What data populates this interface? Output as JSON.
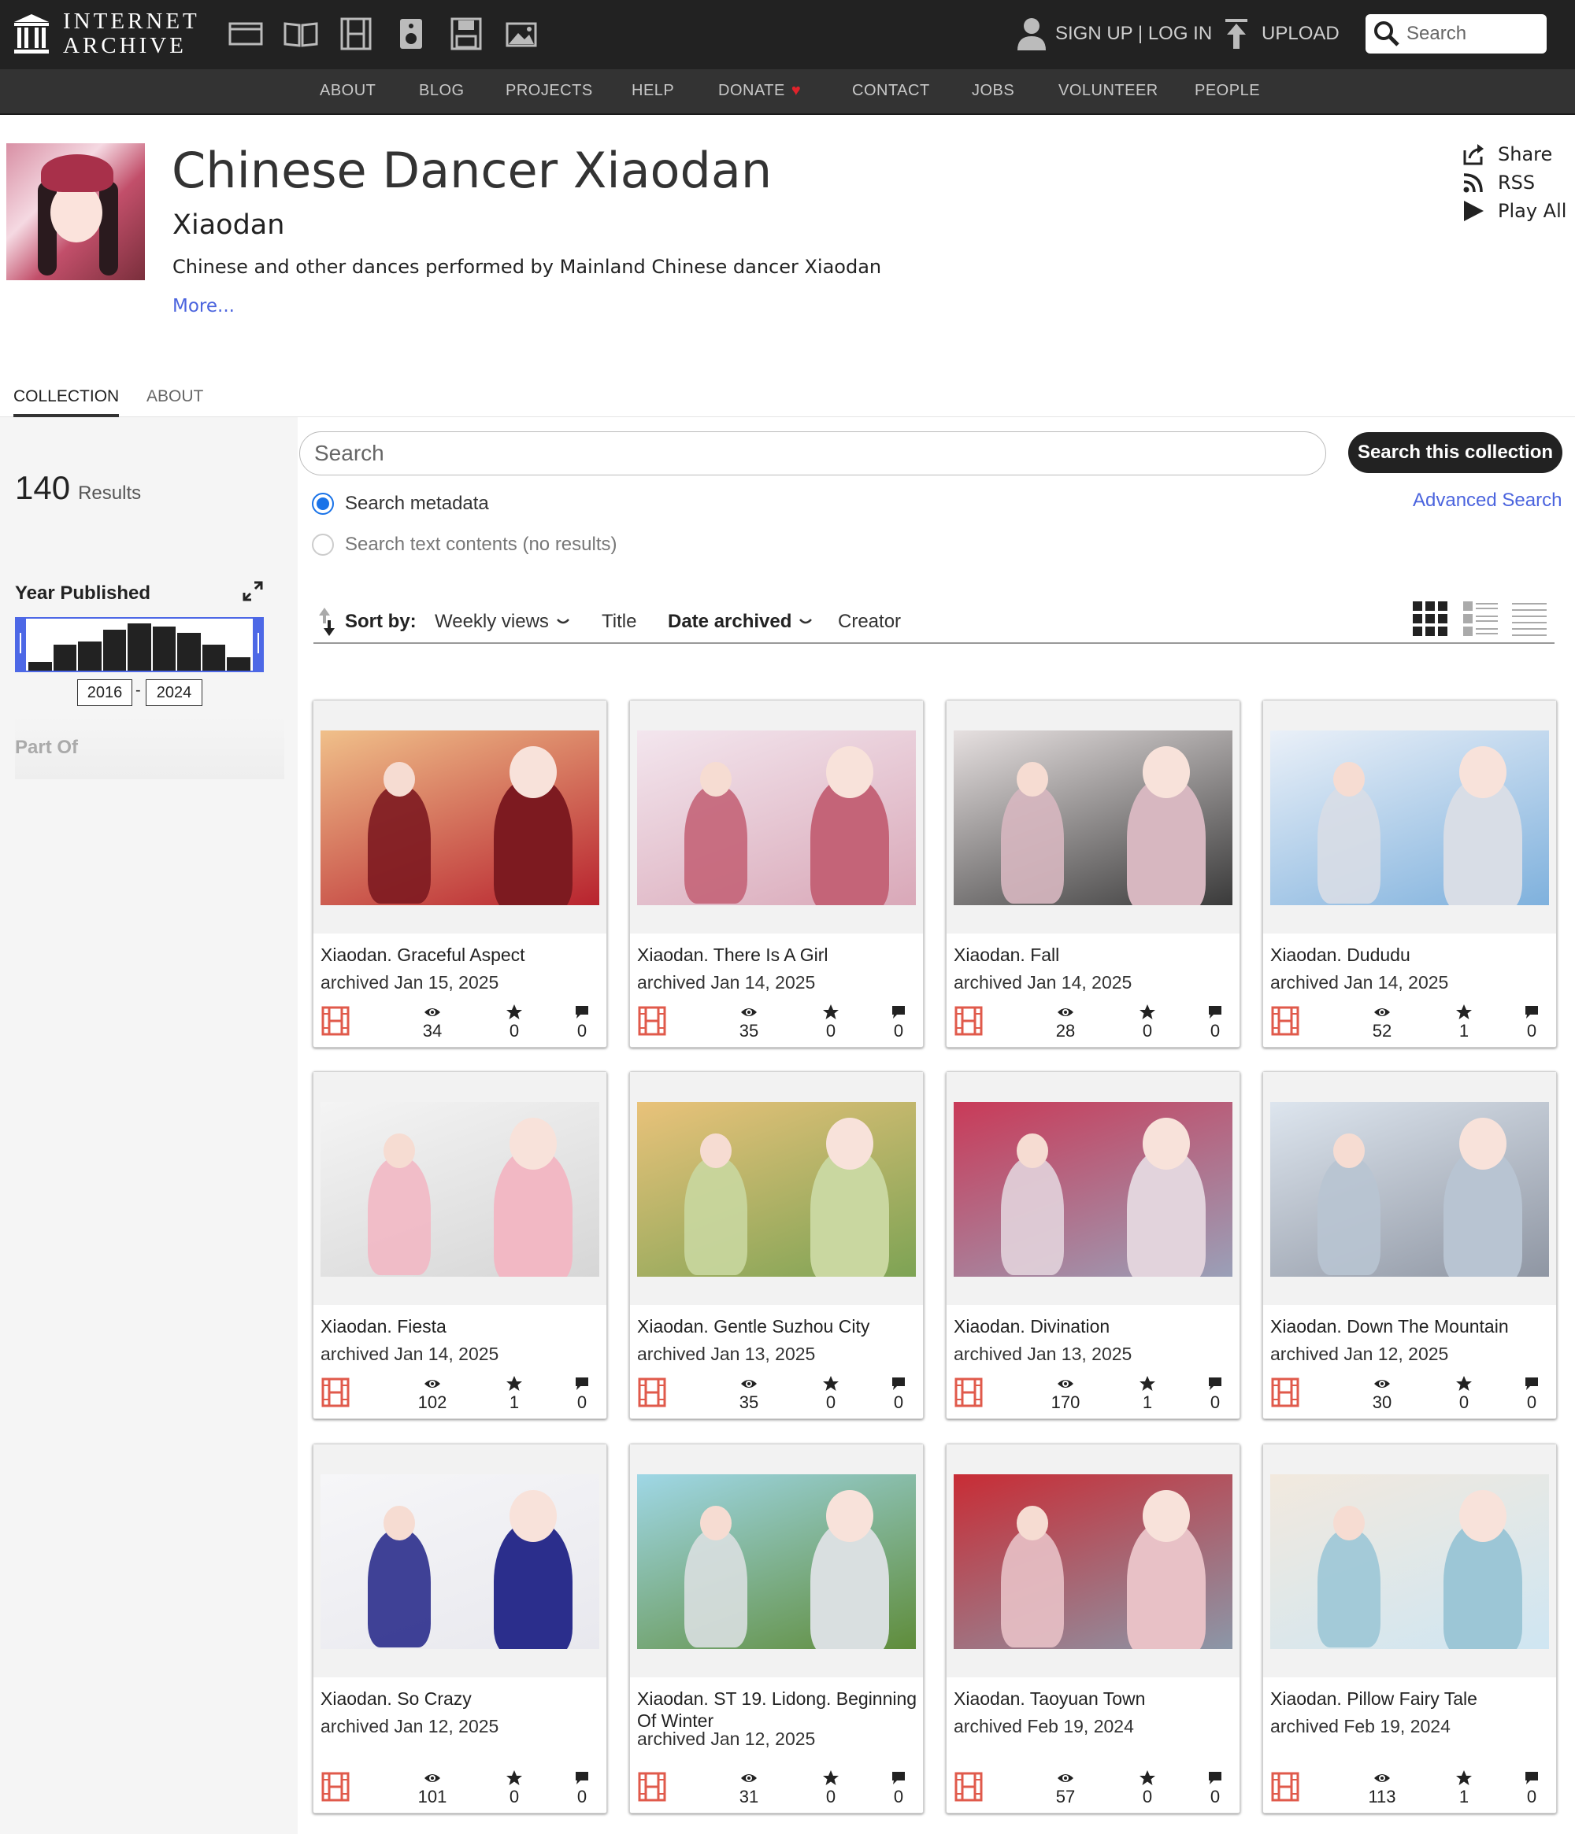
{
  "topbar": {
    "logo_line1": "INTERNET",
    "logo_line2": "ARCHIVE",
    "signup": "SIGN UP | LOG IN",
    "upload": "UPLOAD",
    "search_placeholder": "Search"
  },
  "subnav": [
    "ABOUT",
    "BLOG",
    "PROJECTS",
    "HELP",
    "DONATE",
    "CONTACT",
    "JOBS",
    "VOLUNTEER",
    "PEOPLE"
  ],
  "collection": {
    "title": "Chinese Dancer Xiaodan",
    "subtitle": "Xiaodan",
    "description": "Chinese and other dances performed by Mainland Chinese dancer Xiaodan",
    "more": "More...",
    "actions": [
      "Share",
      "RSS",
      "Play All"
    ]
  },
  "tabs": {
    "collection": "COLLECTION",
    "about": "ABOUT"
  },
  "results": {
    "count": "140",
    "label": "Results"
  },
  "collection_search": {
    "placeholder": "Search",
    "button": "Search this collection",
    "option_metadata": "Search metadata",
    "option_text": "Search text contents (no results)",
    "advanced": "Advanced Search"
  },
  "facets": {
    "year_heading": "Year Published",
    "year_from": "2016",
    "year_to": "2024",
    "histogram": [
      0.18,
      0.55,
      0.62,
      0.86,
      1.0,
      0.94,
      0.8,
      0.55,
      0.28
    ],
    "part_of": "Part Of"
  },
  "sort": {
    "label": "Sort by:",
    "weekly_views": "Weekly views",
    "title": "Title",
    "date_archived": "Date archived",
    "creator": "Creator"
  },
  "colors": {
    "accent": "#4b64de",
    "film": "#e05a4b",
    "topbar": "#222222",
    "subnav": "#333333"
  },
  "items": [
    {
      "title": "Xiaodan. Graceful Aspect",
      "date": "archived Jan 15, 2025",
      "views": "34",
      "favs": "0",
      "reviews": "0"
    },
    {
      "title": "Xiaodan. There Is A Girl",
      "date": "archived Jan 14, 2025",
      "views": "35",
      "favs": "0",
      "reviews": "0"
    },
    {
      "title": "Xiaodan. Fall",
      "date": "archived Jan 14, 2025",
      "views": "28",
      "favs": "0",
      "reviews": "0"
    },
    {
      "title": "Xiaodan. Dududu",
      "date": "archived Jan 14, 2025",
      "views": "52",
      "favs": "1",
      "reviews": "0"
    },
    {
      "title": "Xiaodan. Fiesta",
      "date": "archived Jan 14, 2025",
      "views": "102",
      "favs": "1",
      "reviews": "0"
    },
    {
      "title": "Xiaodan. Gentle Suzhou City",
      "date": "archived Jan 13, 2025",
      "views": "35",
      "favs": "0",
      "reviews": "0"
    },
    {
      "title": "Xiaodan. Divination",
      "date": "archived Jan 13, 2025",
      "views": "170",
      "favs": "1",
      "reviews": "0"
    },
    {
      "title": "Xiaodan. Down The Mountain",
      "date": "archived Jan 12, 2025",
      "views": "30",
      "favs": "0",
      "reviews": "0"
    },
    {
      "title": "Xiaodan. So Crazy",
      "date": "archived Jan 12, 2025",
      "views": "101",
      "favs": "0",
      "reviews": "0"
    },
    {
      "title": "Xiaodan. ST 19. Lidong. Beginning Of Winter",
      "date": "archived Jan 12, 2025",
      "views": "31",
      "favs": "0",
      "reviews": "0"
    },
    {
      "title": "Xiaodan. Taoyuan Town",
      "date": "archived Feb 19, 2024",
      "views": "57",
      "favs": "0",
      "reviews": "0"
    },
    {
      "title": "Xiaodan. Pillow Fairy Tale",
      "date": "archived Feb 19, 2024",
      "views": "113",
      "favs": "1",
      "reviews": "0"
    }
  ]
}
